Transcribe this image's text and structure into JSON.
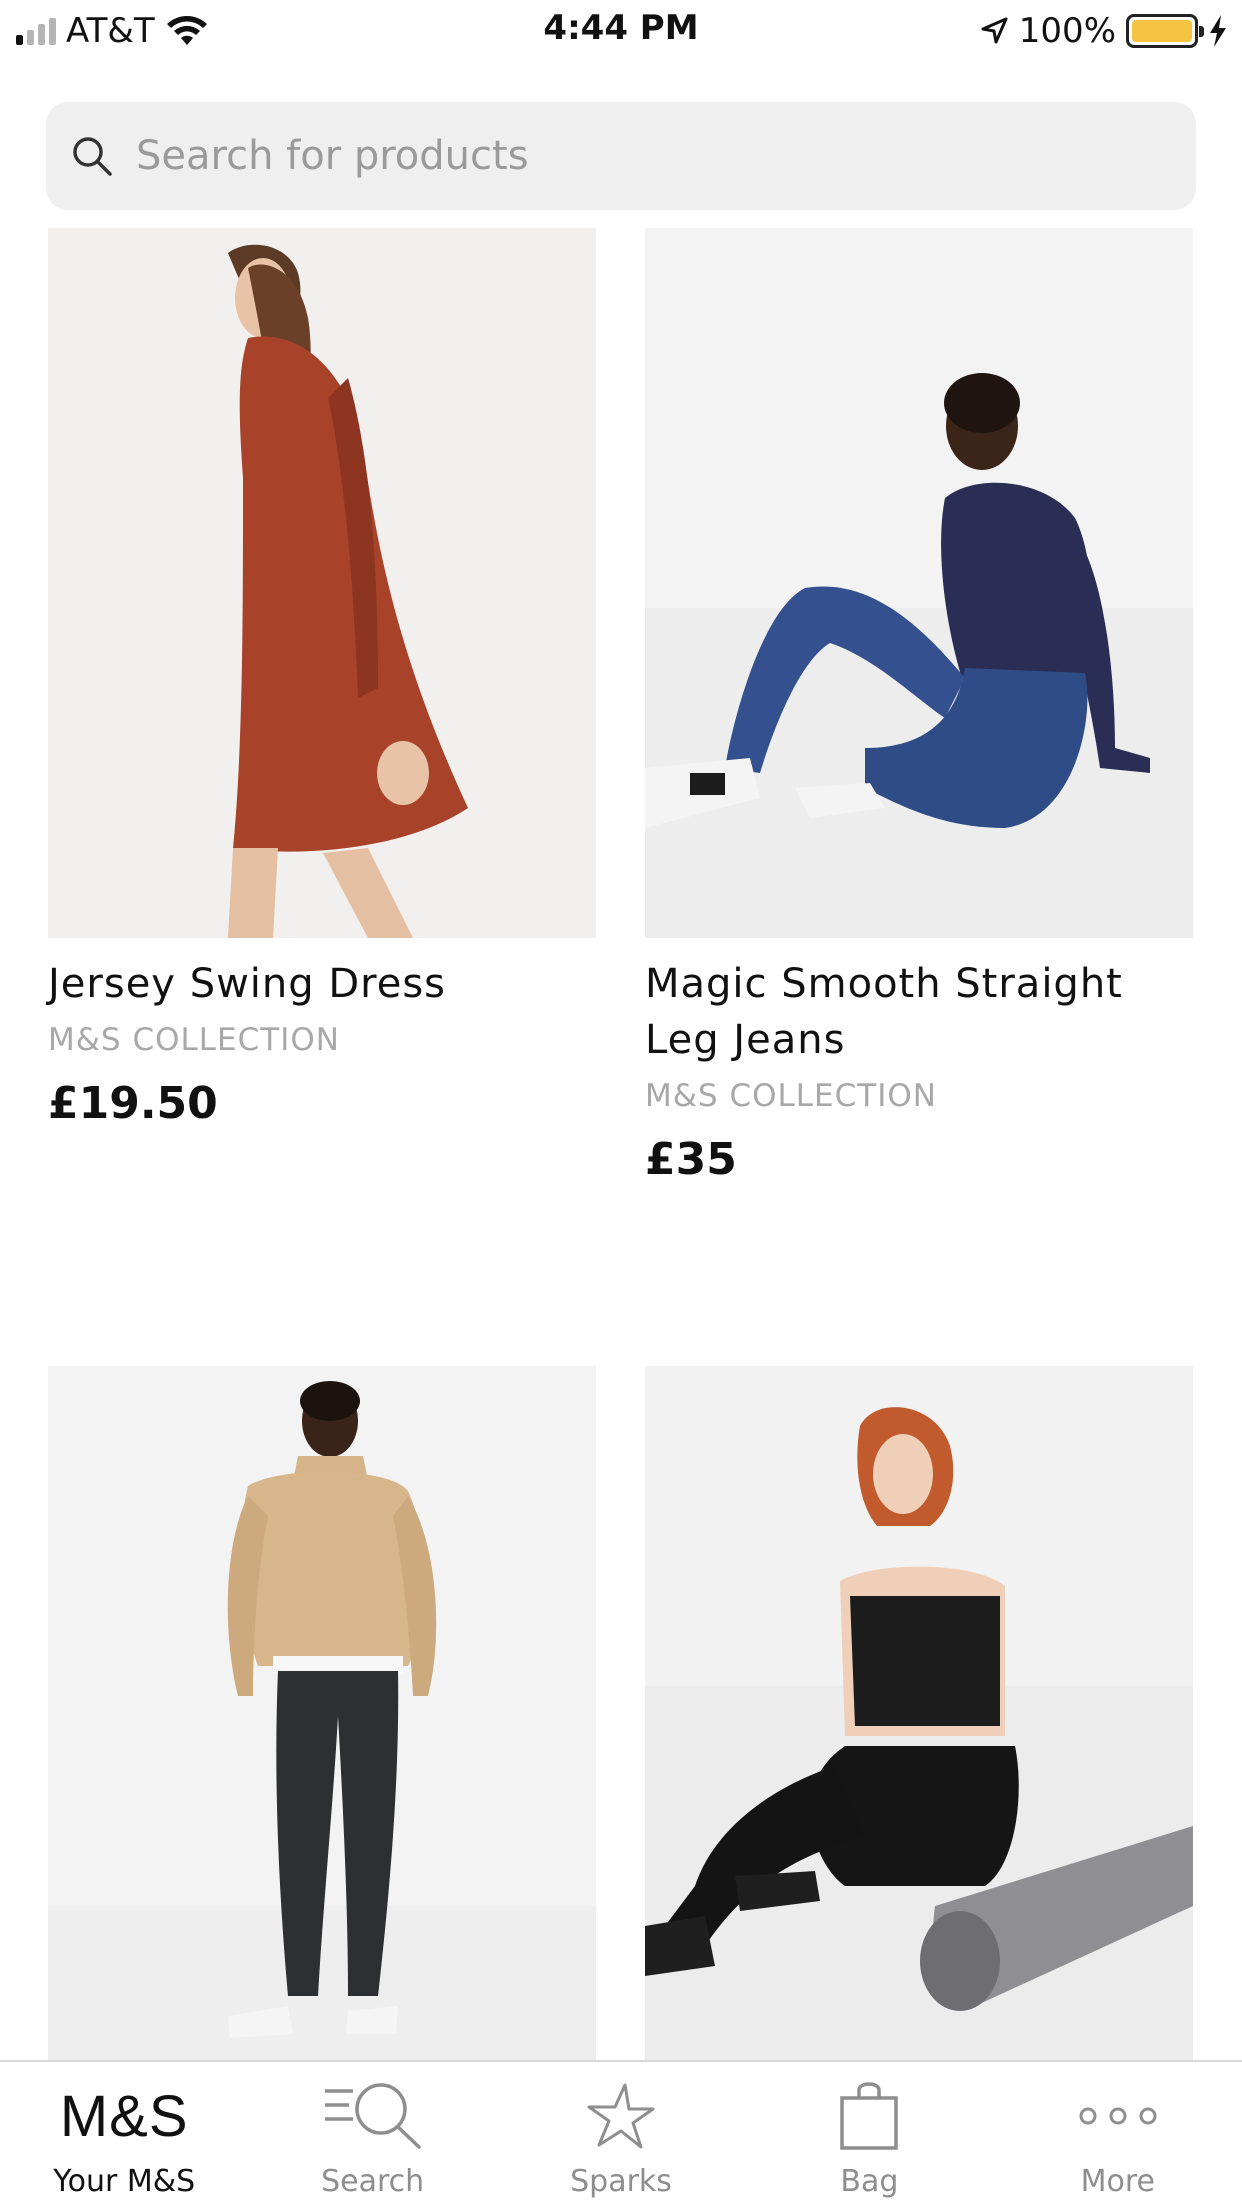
{
  "status_bar": {
    "carrier": "AT&T",
    "time": "4:44 PM",
    "battery": "100%",
    "battery_color": "#f5c443"
  },
  "search": {
    "placeholder": "Search for products",
    "icon": "search-icon"
  },
  "products": [
    {
      "name": "Jersey Swing Dress",
      "brand": "M&S COLLECTION",
      "price": "£19.50"
    },
    {
      "name": "Magic Smooth Straight Leg Jeans",
      "brand": "M&S COLLECTION",
      "price": "£35"
    },
    {
      "name": "",
      "brand": "",
      "price": ""
    },
    {
      "name": "",
      "brand": "",
      "price": ""
    }
  ],
  "tab_bar": {
    "logo": "M&S",
    "items": [
      {
        "label": "Your M&S",
        "icon": "ms-logo-icon",
        "active": true
      },
      {
        "label": "Search",
        "icon": "search-list-icon",
        "active": false
      },
      {
        "label": "Sparks",
        "icon": "star-icon",
        "active": false
      },
      {
        "label": "Bag",
        "icon": "bag-icon",
        "active": false
      },
      {
        "label": "More",
        "icon": "more-dots-icon",
        "active": false
      }
    ]
  }
}
